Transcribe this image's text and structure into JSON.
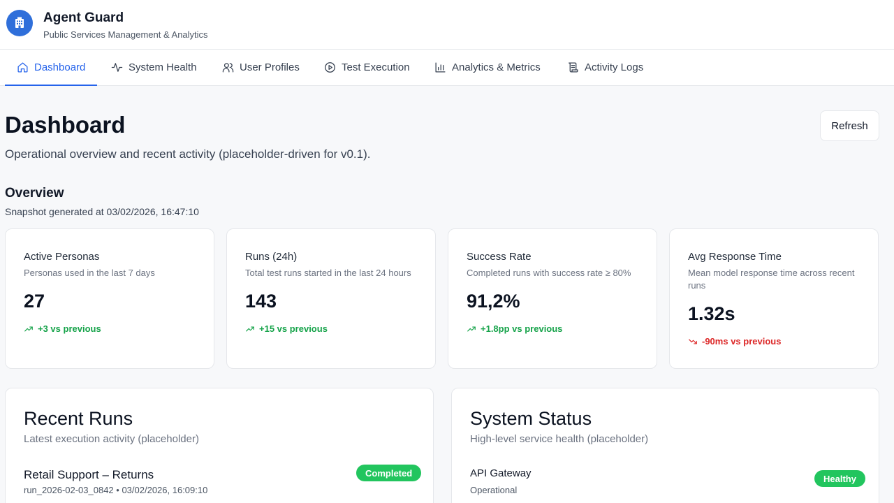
{
  "app": {
    "title": "Agent Guard",
    "subtitle": "Public Services Management & Analytics",
    "logo_icon": "building-icon",
    "accent_color": "#2563eb"
  },
  "nav": {
    "tabs": [
      {
        "label": "Dashboard",
        "icon": "home-icon",
        "active": true
      },
      {
        "label": "System Health",
        "icon": "activity-icon",
        "active": false
      },
      {
        "label": "User Profiles",
        "icon": "users-icon",
        "active": false
      },
      {
        "label": "Test Execution",
        "icon": "play-circle-icon",
        "active": false
      },
      {
        "label": "Analytics & Metrics",
        "icon": "bar-chart-icon",
        "active": false
      },
      {
        "label": "Activity Logs",
        "icon": "scroll-icon",
        "active": false
      }
    ]
  },
  "page": {
    "title": "Dashboard",
    "description": "Operational overview and recent activity (placeholder-driven for v0.1).",
    "refresh_label": "Refresh"
  },
  "overview": {
    "title": "Overview",
    "snapshot": "Snapshot generated at 03/02/2026, 16:47:10",
    "metrics": [
      {
        "title": "Active Personas",
        "description": "Personas used in the last 7 days",
        "value": "27",
        "delta": "+3 vs previous",
        "trend": "up"
      },
      {
        "title": "Runs (24h)",
        "description": "Total test runs started in the last 24 hours",
        "value": "143",
        "delta": "+15 vs previous",
        "trend": "up"
      },
      {
        "title": "Success Rate",
        "description": "Completed runs with success rate ≥ 80%",
        "value": "91,2%",
        "delta": "+1.8pp vs previous",
        "trend": "up"
      },
      {
        "title": "Avg Response Time",
        "description": "Mean model response time across recent runs",
        "value": "1.32s",
        "delta": "-90ms vs previous",
        "trend": "down"
      }
    ]
  },
  "recent_runs": {
    "title": "Recent Runs",
    "subtitle": "Latest execution activity (placeholder)",
    "items": [
      {
        "name": "Retail Support – Returns",
        "meta": "run_2026-02-03_0842 • 03/02/2026, 16:09:10",
        "status": "Completed"
      }
    ]
  },
  "system_status": {
    "title": "System Status",
    "subtitle": "High-level service health (placeholder)",
    "items": [
      {
        "name": "API Gateway",
        "meta": "Operational",
        "status": "Healthy"
      }
    ]
  },
  "colors": {
    "success": "#22c55e",
    "positive_delta": "#16a34a",
    "negative_delta": "#dc2626"
  }
}
